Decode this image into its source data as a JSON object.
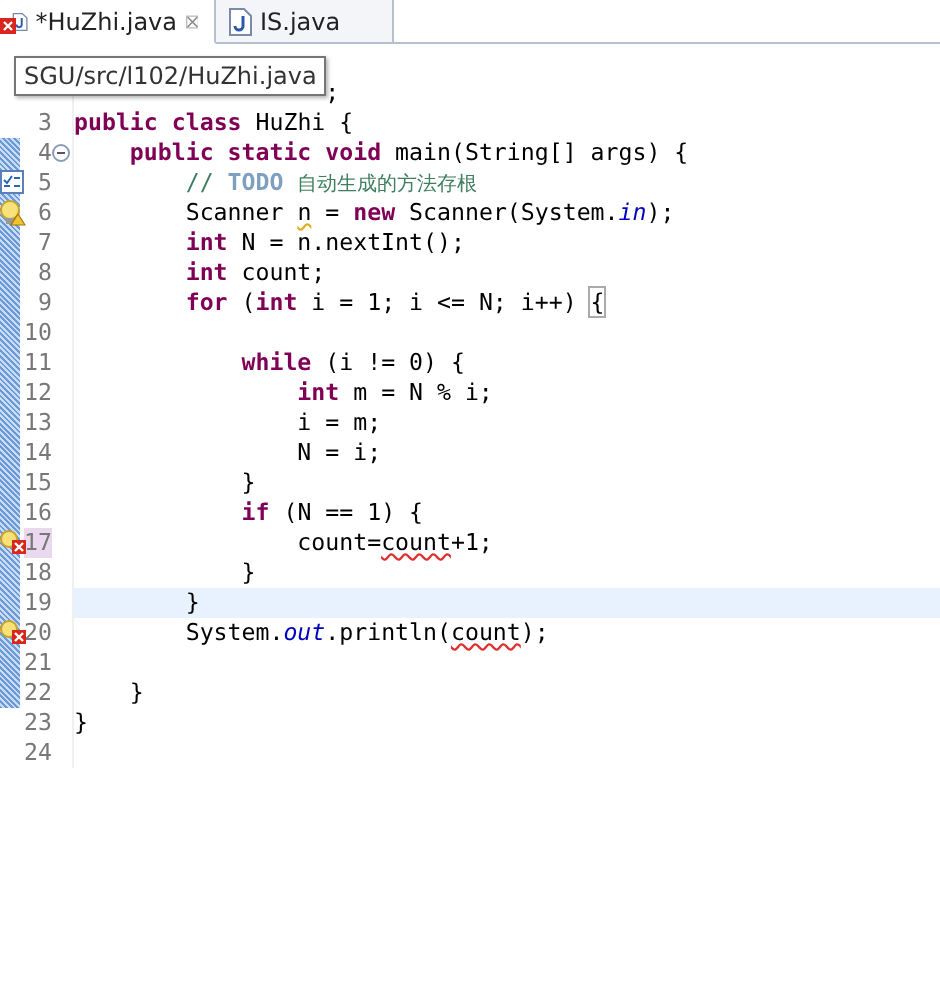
{
  "tabs": [
    {
      "label": "*HuZhi.java",
      "selected": true,
      "error": true
    },
    {
      "label": "IS.java",
      "selected": false,
      "error": false
    }
  ],
  "tooltip": "SGU/src/l102/HuZhi.java",
  "lines": [
    {
      "tokens": [
        {
          "kind": "plain",
          "t": "                  ;"
        }
      ]
    },
    {
      "number": "3",
      "tokens": [
        {
          "kind": "kw",
          "t": "public "
        },
        {
          "kind": "kw",
          "t": "class"
        },
        {
          "kind": "plain",
          "t": " HuZhi {"
        }
      ]
    },
    {
      "number": "4",
      "marker": {
        "kind": "fold"
      },
      "tokens": [
        {
          "kind": "kw",
          "t": "    public "
        },
        {
          "kind": "kw",
          "t": "static "
        },
        {
          "kind": "kw",
          "t": "void"
        },
        {
          "kind": "plain",
          "t": " main(String[] args) {"
        }
      ]
    },
    {
      "number": "5",
      "marker": {
        "kind": "task"
      },
      "tokens": [
        {
          "kind": "comment",
          "t": "        // "
        },
        {
          "kind": "task",
          "t": "TODO "
        },
        {
          "kind": "cjk",
          "t": "自动生成的方法存根"
        }
      ]
    },
    {
      "number": "6",
      "marker": {
        "kind": "warning"
      },
      "tokens": [
        {
          "kind": "plain",
          "t": "        Scanner "
        },
        {
          "kind": "warn",
          "t": "n"
        },
        {
          "kind": "plain",
          "t": " = "
        },
        {
          "kind": "kw",
          "t": "new"
        },
        {
          "kind": "plain",
          "t": " Scanner(System."
        },
        {
          "kind": "field",
          "t": "in"
        },
        {
          "kind": "plain",
          "t": ");"
        }
      ]
    },
    {
      "number": "7",
      "tokens": [
        {
          "kind": "kw",
          "t": "        int"
        },
        {
          "kind": "plain",
          "t": " N = n.nextInt();"
        }
      ]
    },
    {
      "number": "8",
      "tokens": [
        {
          "kind": "kw",
          "t": "        int"
        },
        {
          "kind": "plain",
          "t": " count;"
        }
      ]
    },
    {
      "number": "9",
      "tokens": [
        {
          "kind": "kw",
          "t": "        for"
        },
        {
          "kind": "plain",
          "t": " ("
        },
        {
          "kind": "kw",
          "t": "int"
        },
        {
          "kind": "plain",
          "t": " i = 1; i <= N; i++) "
        },
        {
          "kind": "match",
          "t": "{"
        }
      ]
    },
    {
      "number": "10"
    },
    {
      "number": "11",
      "tokens": [
        {
          "kind": "kw",
          "t": "            while"
        },
        {
          "kind": "plain",
          "t": " (i != 0) {"
        }
      ]
    },
    {
      "number": "12",
      "tokens": [
        {
          "kind": "kw",
          "t": "                int"
        },
        {
          "kind": "plain",
          "t": " m = N % i;"
        }
      ]
    },
    {
      "number": "13",
      "tokens": [
        {
          "kind": "plain",
          "t": "                i = m;"
        }
      ]
    },
    {
      "number": "14",
      "tokens": [
        {
          "kind": "plain",
          "t": "                N = i;"
        }
      ]
    },
    {
      "number": "15",
      "tokens": [
        {
          "kind": "plain",
          "t": "            }"
        }
      ]
    },
    {
      "number": "16",
      "tokens": [
        {
          "kind": "kw",
          "t": "            if"
        },
        {
          "kind": "plain",
          "t": " (N == 1) {"
        }
      ]
    },
    {
      "number": "17",
      "marker": {
        "kind": "error"
      },
      "highlighted": true,
      "tokens": [
        {
          "kind": "plain",
          "t": "                count="
        },
        {
          "kind": "err",
          "t": "count"
        },
        {
          "kind": "plain",
          "t": "+1;"
        }
      ]
    },
    {
      "number": "18",
      "tokens": [
        {
          "kind": "plain",
          "t": "            }"
        }
      ]
    },
    {
      "number": "19",
      "current": true,
      "tokens": [
        {
          "kind": "plain",
          "t": "        }"
        }
      ]
    },
    {
      "number": "20",
      "marker": {
        "kind": "error"
      },
      "tokens": [
        {
          "kind": "plain",
          "t": "        System."
        },
        {
          "kind": "field",
          "t": "out"
        },
        {
          "kind": "plain",
          "t": ".println("
        },
        {
          "kind": "err",
          "t": "count"
        },
        {
          "kind": "plain",
          "t": ");"
        }
      ]
    },
    {
      "number": "21"
    },
    {
      "number": "22",
      "tokens": [
        {
          "kind": "plain",
          "t": "    }"
        }
      ]
    },
    {
      "number": "23",
      "tokens": [
        {
          "kind": "plain",
          "t": "}"
        }
      ]
    },
    {
      "number": "24"
    }
  ]
}
